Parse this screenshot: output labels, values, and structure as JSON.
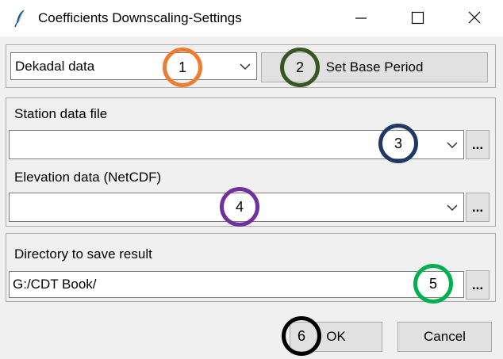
{
  "window": {
    "title": "Coefficients Downscaling-Settings"
  },
  "top_panel": {
    "data_type_select": "Dekadal data",
    "set_base_period_label": "Set Base Period"
  },
  "files_panel": {
    "station_label": "Station data file",
    "station_value": "",
    "elevation_label": "Elevation data (NetCDF)",
    "elevation_value": "",
    "browse_label": "..."
  },
  "output_panel": {
    "directory_label": "Directory to save result",
    "directory_value": "G:/CDT Book/",
    "browse_label": "..."
  },
  "footer": {
    "ok_label": "OK",
    "cancel_label": "Cancel"
  },
  "markers": [
    {
      "number": "1",
      "color": "#ed7d31"
    },
    {
      "number": "2",
      "color": "#375623"
    },
    {
      "number": "3",
      "color": "#1f3864"
    },
    {
      "number": "4",
      "color": "#7030a0"
    },
    {
      "number": "5",
      "color": "#00b050"
    },
    {
      "number": "6",
      "color": "#000000"
    }
  ],
  "icons": [
    "feather-icon",
    "minimize-icon",
    "maximize-icon",
    "close-icon",
    "chevron-down-icon"
  ]
}
